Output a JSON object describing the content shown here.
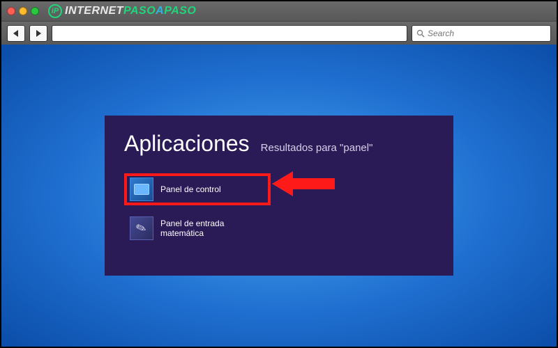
{
  "browser": {
    "logo": {
      "badge": "iP",
      "text_main": "INTERNET",
      "accent1": "PASO",
      "separator": "A",
      "accent2": "PASO"
    },
    "search_placeholder": "Search"
  },
  "apps_panel": {
    "title": "Aplicaciones",
    "subtitle": "Resultados para \"panel\"",
    "results": [
      {
        "label": "Panel de control"
      },
      {
        "label": "Panel de entrada matemática"
      }
    ]
  }
}
